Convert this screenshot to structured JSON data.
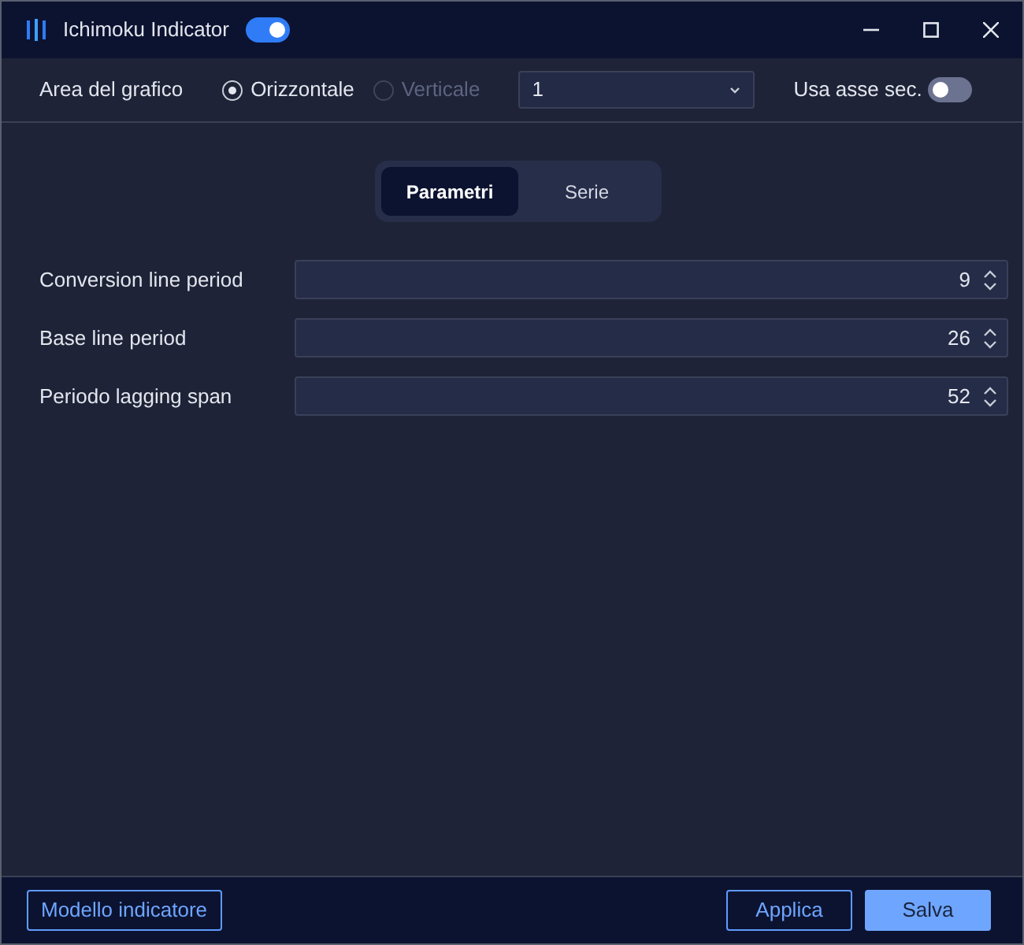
{
  "window": {
    "title": "Ichimoku Indicator",
    "enabled": true
  },
  "toolbar": {
    "label": "Area del grafico",
    "radios": [
      {
        "label": "Orizzontale",
        "selected": true,
        "disabled": false
      },
      {
        "label": "Verticale",
        "selected": false,
        "disabled": true
      }
    ],
    "select": {
      "value": "1"
    },
    "secondary_axis": {
      "label": "Usa asse sec.",
      "on": false
    }
  },
  "tabs": [
    {
      "label": "Parametri",
      "selected": true
    },
    {
      "label": "Serie",
      "selected": false
    }
  ],
  "fields": [
    {
      "label": "Conversion line period",
      "value": "9"
    },
    {
      "label": "Base line period",
      "value": "26"
    },
    {
      "label": "Periodo lagging span",
      "value": "52"
    }
  ],
  "footer": {
    "template_button": "Modello indicatore",
    "apply_button": "Applica",
    "save_button": "Salva"
  }
}
